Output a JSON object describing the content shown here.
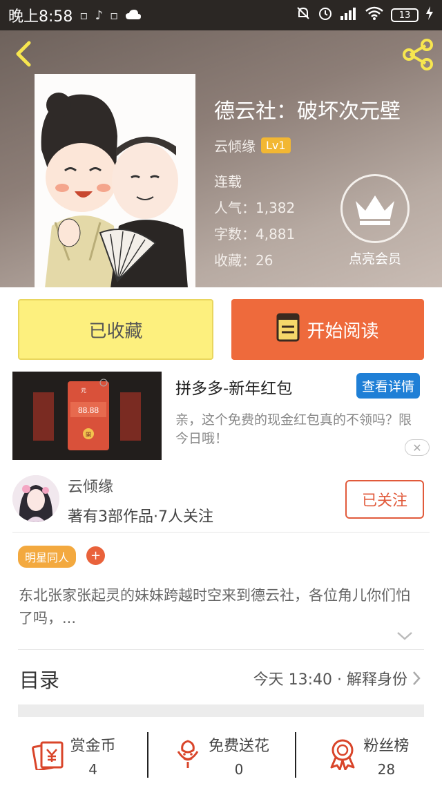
{
  "status_bar": {
    "time": "晚上8:58",
    "battery": "13"
  },
  "book": {
    "title": "德云社：破坏次元壁",
    "author": "云倾缘",
    "level": "Lv1",
    "status": "连载",
    "popularity_label": "人气：1,382",
    "word_count_label": "字数：4,881",
    "favorites_label": "收藏：26",
    "vip_label": "点亮会员"
  },
  "actions": {
    "collected_label": "已收藏",
    "read_label": "开始阅读"
  },
  "ad": {
    "title": "拼多多-新年红包",
    "button": "查看详情",
    "description": "亲，这个免费的现金红包真的不领吗？限今日哦！",
    "image_amount": "88.88",
    "image_unit": "元",
    "image_button": "開"
  },
  "author_info": {
    "name": "云倾缘",
    "stats": "著有3部作品·7人关注",
    "follow_label": "已关注"
  },
  "tag": "明星同人",
  "tag_add": "+",
  "description": "东北张家张起灵的妹妹跨越时空来到德云社，各位角儿你们怕了吗，...",
  "toc": {
    "label": "目录",
    "latest": "今天 13:40 · 解释身份"
  },
  "stats": [
    {
      "label": "赏金币",
      "value": "4",
      "icon": "coin-envelope-icon"
    },
    {
      "label": "免费送花",
      "value": "0",
      "icon": "flower-icon"
    },
    {
      "label": "粉丝榜",
      "value": "28",
      "icon": "medal-icon"
    }
  ],
  "colors": {
    "accent_orange": "#ee6a3c",
    "collected_yellow": "#fdf07e",
    "ad_blue": "#1f7fd6",
    "follow_red": "#e15a3b",
    "tag_orange": "#f3a93f"
  }
}
